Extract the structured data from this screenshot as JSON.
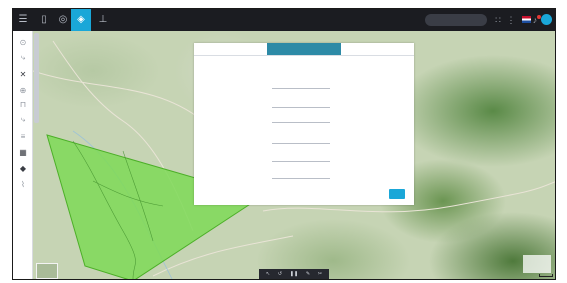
{
  "topbar": {
    "left_buttons": [
      {
        "icon": "menu-icon",
        "glyph": "☰",
        "active": false
      },
      {
        "icon": "document-icon",
        "glyph": "▯",
        "active": false
      },
      {
        "icon": "settings-icon",
        "glyph": "◎",
        "active": false
      },
      {
        "icon": "layers-icon",
        "glyph": "◈",
        "active": true
      },
      {
        "icon": "chart-icon",
        "glyph": "⊥",
        "active": false
      }
    ],
    "right_icons": [
      "grid-icon",
      "flag-icon",
      "notification-icon",
      "globe-icon",
      "user-avatar-icon"
    ],
    "active_color": "#1aa7d8"
  },
  "sidebar": {
    "items": [
      {
        "icon": "target-icon",
        "glyph": "⊙"
      },
      {
        "icon": "pin-icon",
        "glyph": "⤷"
      },
      {
        "icon": "cross-tools-icon",
        "glyph": "✕"
      },
      {
        "icon": "compass-icon",
        "glyph": "⊕"
      },
      {
        "icon": "ruler-icon",
        "glyph": "⊓"
      },
      {
        "icon": "edit-icon",
        "glyph": "⤷"
      },
      {
        "icon": "list-icon",
        "glyph": "≡"
      },
      {
        "icon": "table-icon",
        "glyph": "▦"
      },
      {
        "icon": "tag-icon",
        "glyph": "◆"
      },
      {
        "icon": "measure-icon",
        "glyph": "⌇"
      }
    ]
  },
  "panel": {
    "tabs": [
      {
        "label": "",
        "active": false
      },
      {
        "label": "",
        "active": true
      },
      {
        "label": "",
        "active": false
      }
    ],
    "section_title": "",
    "fields": [
      {
        "label": "",
        "value": ""
      },
      {
        "label": "",
        "value": ""
      },
      {
        "label": "",
        "value": ""
      },
      {
        "label": "",
        "value": ""
      },
      {
        "label": "",
        "value": ""
      },
      {
        "label": "",
        "value": ""
      }
    ],
    "submit_label": ""
  },
  "bottom_toolbar": {
    "buttons": [
      {
        "icon": "cursor-icon",
        "glyph": "↖"
      },
      {
        "icon": "undo-icon",
        "glyph": "↺"
      },
      {
        "icon": "pause-icon",
        "glyph": "❚❚"
      },
      {
        "icon": "draw-icon",
        "glyph": "✎"
      },
      {
        "icon": "erase-icon",
        "glyph": "✂"
      }
    ]
  },
  "map": {
    "polygon_fill": "#7ed957",
    "polygon_stroke": "#4caf28",
    "attribution": ""
  }
}
